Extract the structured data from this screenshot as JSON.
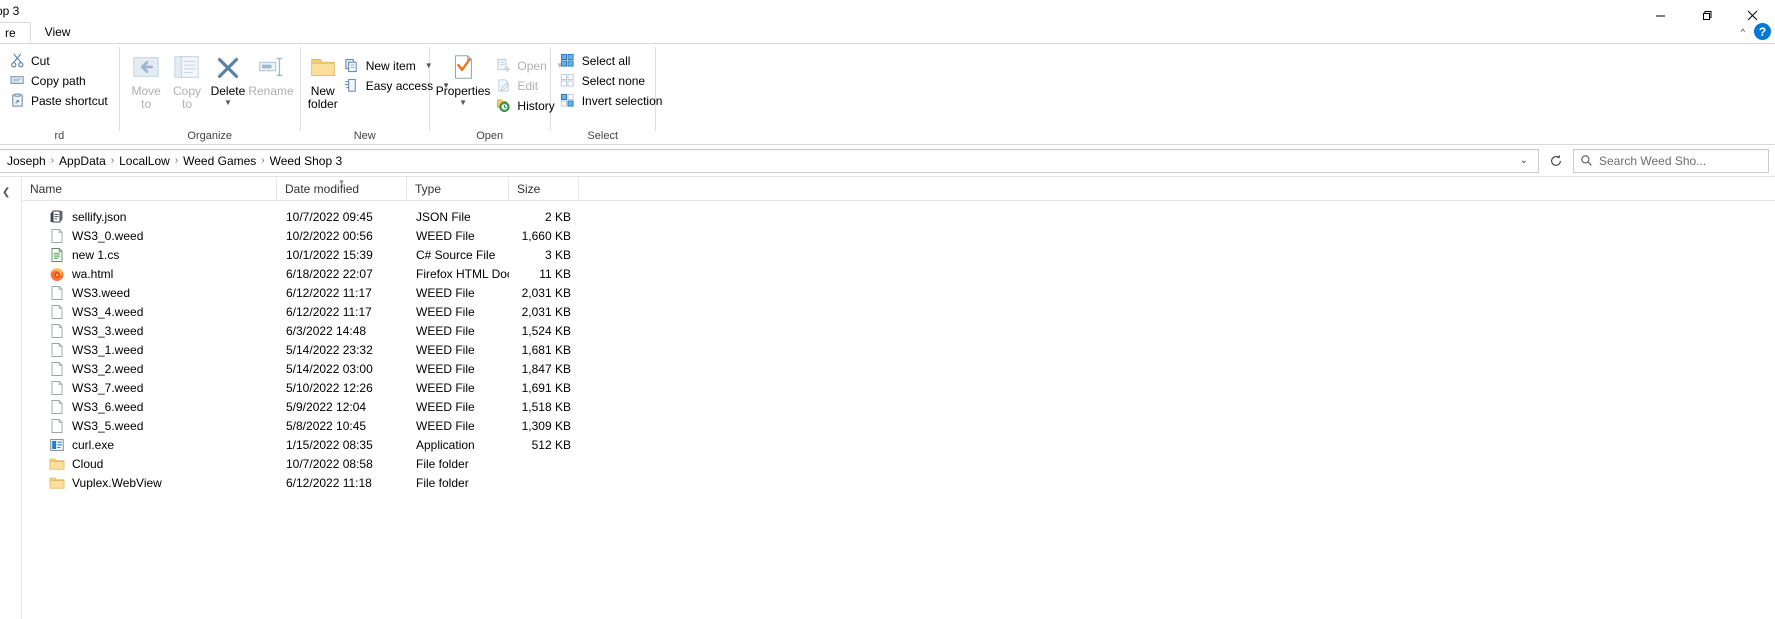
{
  "window": {
    "title": "op 3",
    "minimize_label": "Minimize",
    "maximize_label": "Maximize",
    "close_label": "Close"
  },
  "tabs": [
    {
      "label": "re",
      "name": "tab-share"
    },
    {
      "label": "View",
      "name": "tab-view"
    }
  ],
  "tab_right": {
    "collapse_label": "^",
    "help_label": "?"
  },
  "ribbon": {
    "groups": [
      {
        "name": "clipboard",
        "label": "rd",
        "commands": [
          {
            "label": "Cut",
            "icon": "scissors-icon",
            "disabled": false
          },
          {
            "label": "Copy path",
            "icon": "copy-path-icon",
            "disabled": false
          },
          {
            "label": "Paste shortcut",
            "icon": "paste-shortcut-icon",
            "disabled": false
          }
        ]
      },
      {
        "name": "organize",
        "label": "Organize",
        "big": [
          {
            "label": "Move",
            "label2": "to",
            "icon": "move-to-icon",
            "disabled": true,
            "caret": true
          },
          {
            "label": "Copy",
            "label2": "to",
            "icon": "copy-to-icon",
            "disabled": true,
            "caret": true
          },
          {
            "label": "Delete",
            "label2": "",
            "icon": "delete-icon",
            "disabled": false,
            "caret": true
          },
          {
            "label": "Rename",
            "label2": "",
            "icon": "rename-icon",
            "disabled": true,
            "caret": false
          }
        ]
      },
      {
        "name": "new",
        "label": "New",
        "big": [
          {
            "label": "New",
            "label2": "folder",
            "icon": "new-folder-icon",
            "disabled": false,
            "caret": false
          }
        ],
        "commands": [
          {
            "label": "New item",
            "icon": "new-item-icon",
            "disabled": false,
            "caret": true
          },
          {
            "label": "Easy access",
            "icon": "easy-access-icon",
            "disabled": false,
            "caret": true
          }
        ]
      },
      {
        "name": "open",
        "label": "Open",
        "big": [
          {
            "label": "Properties",
            "label2": "",
            "icon": "properties-icon",
            "disabled": false,
            "caret": true
          }
        ],
        "commands": [
          {
            "label": "Open",
            "icon": "open-icon",
            "disabled": true,
            "caret": true
          },
          {
            "label": "Edit",
            "icon": "edit-icon",
            "disabled": true
          },
          {
            "label": "History",
            "icon": "history-icon",
            "disabled": false
          }
        ]
      },
      {
        "name": "select",
        "label": "Select",
        "commands": [
          {
            "label": "Select all",
            "icon": "select-all-icon",
            "disabled": false
          },
          {
            "label": "Select none",
            "icon": "select-none-icon",
            "disabled": false
          },
          {
            "label": "Invert selection",
            "icon": "invert-selection-icon",
            "disabled": false
          }
        ]
      }
    ]
  },
  "address": {
    "crumbs": [
      "Joseph",
      "AppData",
      "LocalLow",
      "Weed Games",
      "Weed Shop 3"
    ],
    "separator": "›",
    "dropdown_label": "⌄",
    "refresh_label": "Refresh",
    "search_placeholder": "Search Weed Sho..."
  },
  "columns": [
    {
      "label": "Name",
      "name": "column-header-name",
      "sorted": false
    },
    {
      "label": "Date modified",
      "name": "column-header-date-modified",
      "sorted": true
    },
    {
      "label": "Type",
      "name": "column-header-type",
      "sorted": false
    },
    {
      "label": "Size",
      "name": "column-header-size",
      "sorted": false
    }
  ],
  "files": [
    {
      "name": "sellify.json",
      "date": "10/7/2022 09:45",
      "type": "JSON File",
      "size": "2 KB",
      "icon": "json-file-icon"
    },
    {
      "name": "WS3_0.weed",
      "date": "10/2/2022 00:56",
      "type": "WEED File",
      "size": "1,660 KB",
      "icon": "blank-file-icon"
    },
    {
      "name": "new 1.cs",
      "date": "10/1/2022 15:39",
      "type": "C# Source File",
      "size": "3 KB",
      "icon": "cs-file-icon"
    },
    {
      "name": "wa.html",
      "date": "6/18/2022 22:07",
      "type": "Firefox HTML Doc...",
      "size": "11 KB",
      "icon": "firefox-html-icon"
    },
    {
      "name": "WS3.weed",
      "date": "6/12/2022 11:17",
      "type": "WEED File",
      "size": "2,031 KB",
      "icon": "blank-file-icon"
    },
    {
      "name": "WS3_4.weed",
      "date": "6/12/2022 11:17",
      "type": "WEED File",
      "size": "2,031 KB",
      "icon": "blank-file-icon"
    },
    {
      "name": "WS3_3.weed",
      "date": "6/3/2022 14:48",
      "type": "WEED File",
      "size": "1,524 KB",
      "icon": "blank-file-icon"
    },
    {
      "name": "WS3_1.weed",
      "date": "5/14/2022 23:32",
      "type": "WEED File",
      "size": "1,681 KB",
      "icon": "blank-file-icon"
    },
    {
      "name": "WS3_2.weed",
      "date": "5/14/2022 03:00",
      "type": "WEED File",
      "size": "1,847 KB",
      "icon": "blank-file-icon"
    },
    {
      "name": "WS3_7.weed",
      "date": "5/10/2022 12:26",
      "type": "WEED File",
      "size": "1,691 KB",
      "icon": "blank-file-icon"
    },
    {
      "name": "WS3_6.weed",
      "date": "5/9/2022 12:04",
      "type": "WEED File",
      "size": "1,518 KB",
      "icon": "blank-file-icon"
    },
    {
      "name": "WS3_5.weed",
      "date": "5/8/2022 10:45",
      "type": "WEED File",
      "size": "1,309 KB",
      "icon": "blank-file-icon"
    },
    {
      "name": "curl.exe",
      "date": "1/15/2022 08:35",
      "type": "Application",
      "size": "512 KB",
      "icon": "exe-file-icon"
    },
    {
      "name": "Cloud",
      "date": "10/7/2022 08:58",
      "type": "File folder",
      "size": "",
      "icon": "folder-icon"
    },
    {
      "name": "Vuplex.WebView",
      "date": "6/12/2022 11:18",
      "type": "File folder",
      "size": "",
      "icon": "folder-icon"
    }
  ],
  "colors": {
    "accent": "#0078d7",
    "folder": "#f5cf7e",
    "ribbon_icon": "#5b81a6",
    "close_hover": "#e81123"
  }
}
